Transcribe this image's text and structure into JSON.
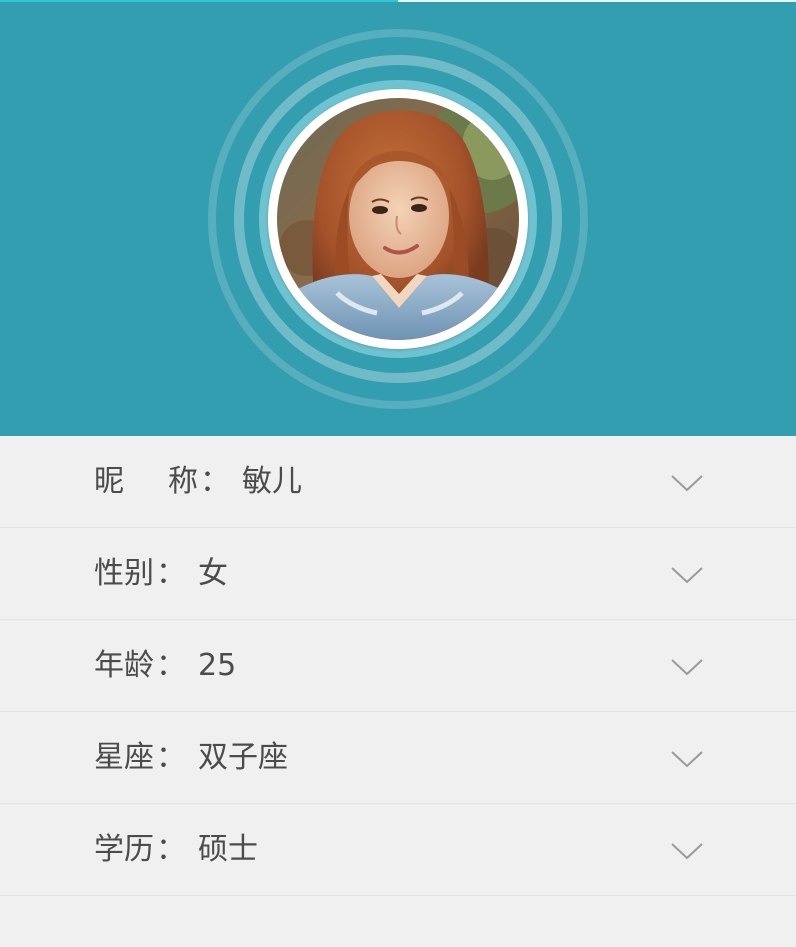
{
  "progress": 0.5,
  "colors": {
    "header_bg": "#349eb1",
    "progress": "#2fc7d3",
    "list_bg": "#f0f0f0",
    "text": "#4b4b4b",
    "chevron": "#9a9a9a"
  },
  "profile": {
    "avatar_icon": "profile-photo"
  },
  "fields": [
    {
      "label": "昵称",
      "colon": "：",
      "value": "敏儿"
    },
    {
      "label": "性别",
      "colon": "：",
      "value": "女"
    },
    {
      "label": "年龄",
      "colon": "：",
      "value": "25"
    },
    {
      "label": "星座",
      "colon": "：",
      "value": "双子座"
    },
    {
      "label": "学历",
      "colon": "：",
      "value": "硕士"
    }
  ],
  "chevron_icon": "chevron-down-icon"
}
